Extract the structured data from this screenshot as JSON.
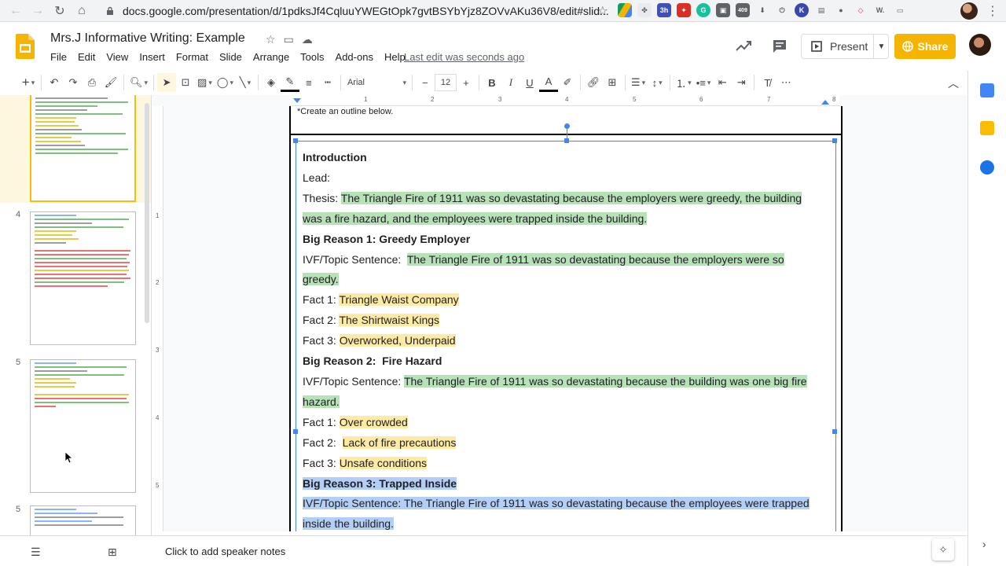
{
  "browser": {
    "url": "docs.google.com/presentation/d/1pdksJf4CqluuYWEGtOpk7gvtBSYbYjz8ZOVvAKu36V8/edit#slid...",
    "extension_badge": "409"
  },
  "header": {
    "doc_title": "Mrs.J  Informative Writing: Example",
    "menu": [
      "File",
      "Edit",
      "View",
      "Insert",
      "Format",
      "Slide",
      "Arrange",
      "Tools",
      "Add-ons",
      "Help"
    ],
    "last_edit": "Last edit was seconds ago",
    "present_label": "Present",
    "share_label": "Share"
  },
  "toolbar": {
    "font": "Arial",
    "font_size": "12"
  },
  "filmstrip": {
    "slide_numbers": [
      "4",
      "5",
      "5"
    ]
  },
  "slide": {
    "instruction": "*Create an outline below.",
    "lines": [
      {
        "label": "Introduction",
        "bold": true,
        "text": "",
        "hl": ""
      },
      {
        "label": "Lead:",
        "bold": false,
        "text": "",
        "hl": ""
      },
      {
        "label": "Thesis: ",
        "bold": false,
        "text": "The Triangle Fire of 1911 was so devastating because the employers were greedy, the building",
        "hl": "g"
      },
      {
        "label": "",
        "bold": false,
        "text": "was a fire hazard, and the employees were trapped inside the building.",
        "hl": "g"
      },
      {
        "label": "Big Reason 1: Greedy Employer",
        "bold": true,
        "text": "",
        "hl": ""
      },
      {
        "label": "IVF/Topic Sentence:  ",
        "bold": false,
        "text": "The Triangle Fire of 1911 was so devastating because the employers were so",
        "hl": "g"
      },
      {
        "label": "",
        "bold": false,
        "text": "greedy.",
        "hl": "g"
      },
      {
        "label": "Fact 1: ",
        "bold": false,
        "text": "Triangle Waist Company",
        "hl": "y"
      },
      {
        "label": "Fact 2: ",
        "bold": false,
        "text": "The Shirtwaist Kings",
        "hl": "y"
      },
      {
        "label": "Fact 3: ",
        "bold": false,
        "text": "Overworked, Underpaid",
        "hl": "y"
      },
      {
        "label": "Big Reason 2:  Fire Hazard",
        "bold": true,
        "text": "",
        "hl": ""
      },
      {
        "label": "IVF/Topic Sentence: ",
        "bold": false,
        "text": "The Triangle Fire of 1911 was so devastating because the building was one big fire",
        "hl": "g"
      },
      {
        "label": "",
        "bold": false,
        "text": "hazard.",
        "hl": "g"
      },
      {
        "label": "Fact 1: ",
        "bold": false,
        "text": "Over crowded",
        "hl": "y"
      },
      {
        "label": "Fact 2:  ",
        "bold": false,
        "text": "Lack of fire precautions",
        "hl": "y"
      },
      {
        "label": "Fact 3: ",
        "bold": false,
        "text": "Unsafe conditions",
        "hl": "y"
      },
      {
        "label": "",
        "bold": true,
        "text": "Big Reason 3: Trapped Inside",
        "hl": "sel"
      },
      {
        "label": "",
        "bold": false,
        "text": "IVF/Topic Sentence:  The Triangle Fire of 1911 was so devastating because the employees were trapped",
        "hl": "sel"
      },
      {
        "label": "",
        "bold": false,
        "text": "inside the building.",
        "hl": "sel"
      }
    ]
  },
  "notes": {
    "placeholder": "Click to add speaker notes"
  },
  "colors": {
    "accent": "#4285f4",
    "share": "#f4b400",
    "highlight_green": "#b7e1b7",
    "highlight_yellow": "#fdeaa5",
    "selection": "#b4cff7"
  }
}
